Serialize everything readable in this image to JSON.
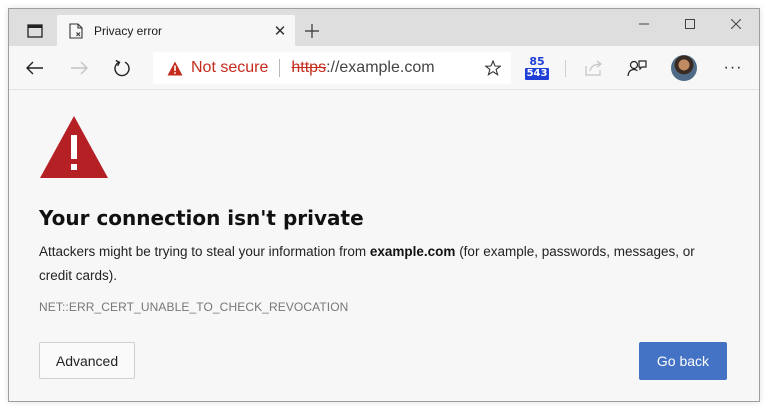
{
  "tab": {
    "title": "Privacy error",
    "close_glyph": "✕",
    "new_tab_glyph": "+"
  },
  "window_controls": {
    "minimize": "─",
    "maximize": "☐",
    "close": "✕"
  },
  "toolbar": {
    "security_label": "Not secure",
    "url_scheme": "https",
    "url_rest": "://example.com",
    "extension_badge_top": "85",
    "extension_badge_bottom": "543",
    "more_glyph": "···"
  },
  "content": {
    "heading": "Your connection isn't private",
    "desc_before": "Attackers might be trying to steal your information from ",
    "desc_domain": "example.com",
    "desc_after": " (for example, passwords, messages, or credit cards).",
    "error_code": "NET::ERR_CERT_UNABLE_TO_CHECK_REVOCATION",
    "advanced_label": "Advanced",
    "go_back_label": "Go back"
  },
  "colors": {
    "warning_red": "#b52025",
    "primary_button": "#4472c4",
    "not_secure_text": "#c42b1c"
  }
}
